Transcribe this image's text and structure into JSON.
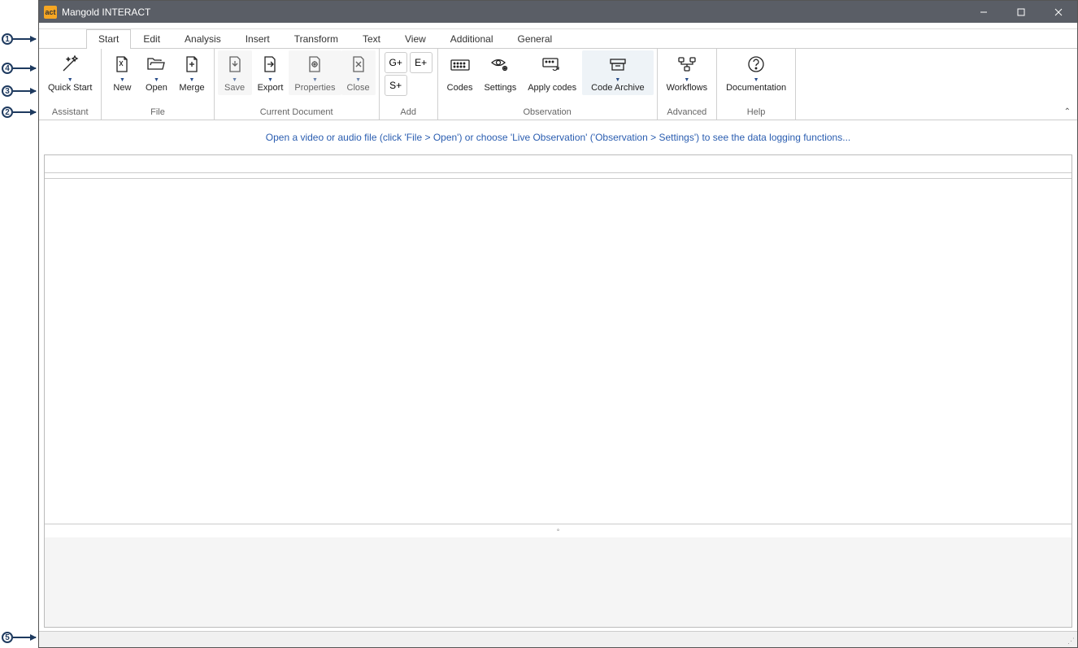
{
  "window": {
    "title": "Mangold INTERACT",
    "icon_text": "act"
  },
  "tabs": [
    {
      "label": "Start",
      "active": true
    },
    {
      "label": "Edit"
    },
    {
      "label": "Analysis"
    },
    {
      "label": "Insert"
    },
    {
      "label": "Transform"
    },
    {
      "label": "Text"
    },
    {
      "label": "View"
    },
    {
      "label": "Additional"
    },
    {
      "label": "General"
    }
  ],
  "ribbon": {
    "groups": {
      "assistant": {
        "label": "Assistant",
        "buttons": {
          "quick_start": "Quick Start"
        }
      },
      "file": {
        "label": "File",
        "buttons": {
          "new": "New",
          "open": "Open",
          "merge": "Merge"
        }
      },
      "current_document": {
        "label": "Current Document",
        "buttons": {
          "save": "Save",
          "export": "Export",
          "properties": "Properties",
          "close": "Close"
        }
      },
      "add": {
        "label": "Add",
        "buttons": {
          "g_plus": "G+",
          "e_plus": "E+",
          "s_plus": "S+"
        }
      },
      "observation": {
        "label": "Observation",
        "buttons": {
          "codes": "Codes",
          "settings": "Settings",
          "apply_codes": "Apply codes",
          "code_archive": "Code Archive"
        }
      },
      "advanced": {
        "label": "Advanced",
        "buttons": {
          "workflows": "Workflows"
        }
      },
      "help": {
        "label": "Help",
        "buttons": {
          "documentation": "Documentation"
        }
      }
    }
  },
  "hint": "Open a video or audio file (click 'File > Open') or choose 'Live Observation' ('Observation > Settings') to see the data logging functions...",
  "annotations": {
    "a1": "1",
    "a2": "2",
    "a3": "3",
    "a4": "4",
    "a5": "5"
  }
}
